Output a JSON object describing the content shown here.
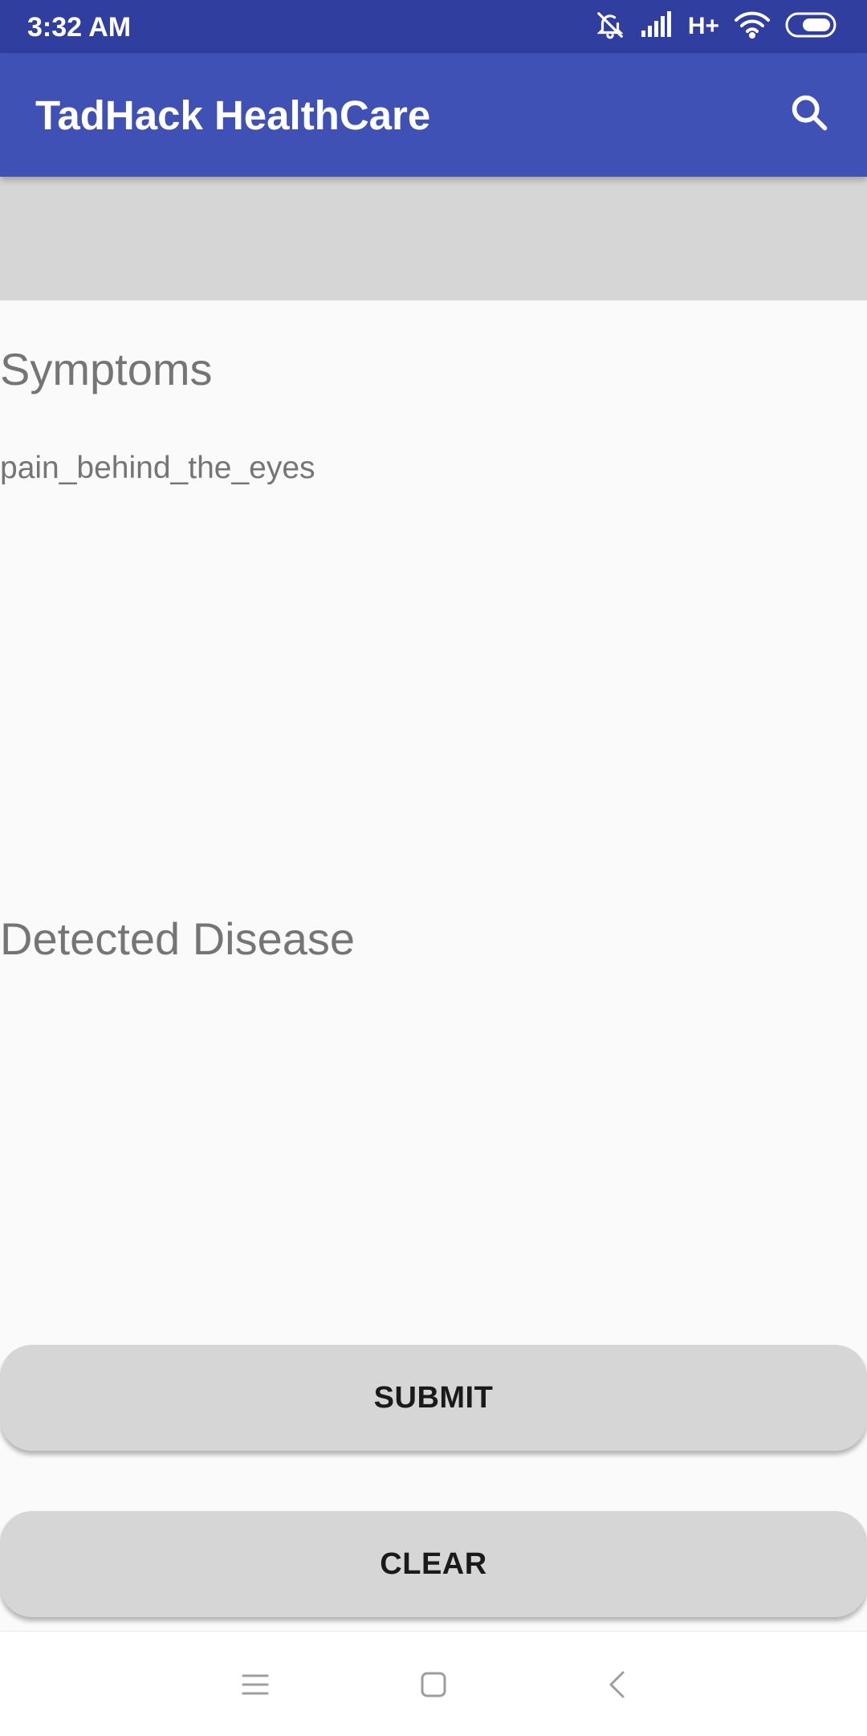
{
  "status_bar": {
    "time": "3:32 AM",
    "network_type": "H+",
    "icons": [
      "muted-bell-icon",
      "signal-icon",
      "wifi-icon",
      "battery-icon"
    ]
  },
  "app_bar": {
    "title": "TadHack HealthCare",
    "search_icon": "search-icon",
    "background_color": "#3f51b5",
    "status_color": "#303f9f"
  },
  "symptoms": {
    "heading": "Symptoms",
    "items": [
      "pain_behind_the_eyes"
    ]
  },
  "detected": {
    "heading": "Detected Disease"
  },
  "buttons": {
    "submit": "SUBMIT",
    "clear": "CLEAR"
  },
  "nav_bar": {
    "icons": [
      "menu-icon",
      "home-icon",
      "back-icon"
    ]
  }
}
